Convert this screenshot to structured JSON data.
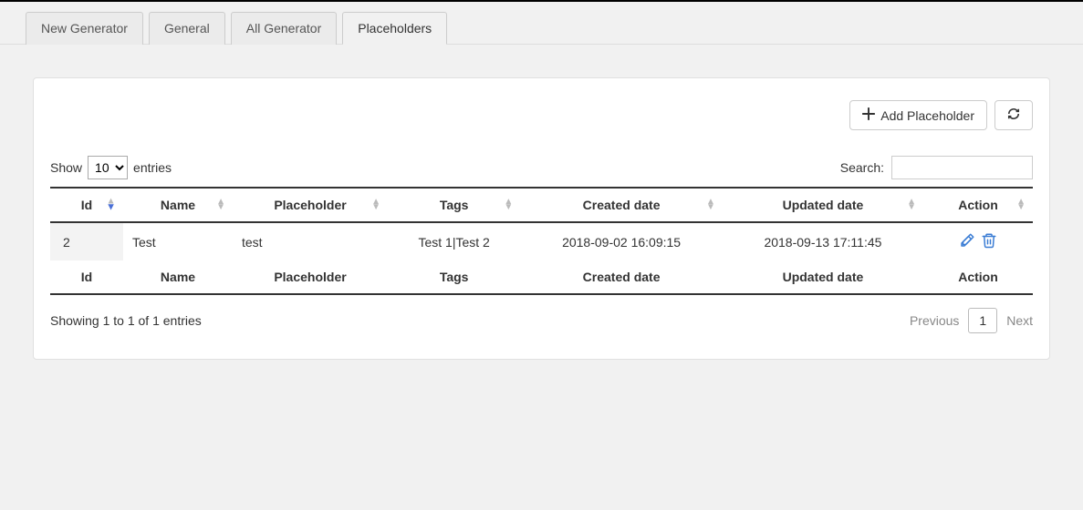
{
  "tabs": [
    {
      "label": "New Generator",
      "active": false
    },
    {
      "label": "General",
      "active": false
    },
    {
      "label": "All Generator",
      "active": false
    },
    {
      "label": "Placeholders",
      "active": true
    }
  ],
  "toolbar": {
    "add_button": "Add Placeholder"
  },
  "length": {
    "show_label": "Show",
    "entries_label": "entries",
    "selected": "10"
  },
  "search": {
    "label": "Search:",
    "value": ""
  },
  "columns": {
    "id": "Id",
    "name": "Name",
    "placeholder": "Placeholder",
    "tags": "Tags",
    "created": "Created date",
    "updated": "Updated date",
    "action": "Action"
  },
  "rows": [
    {
      "id": "2",
      "name": "Test",
      "placeholder": "test",
      "tags": "Test 1|Test 2",
      "created": "2018-09-02 16:09:15",
      "updated": "2018-09-13 17:11:45"
    }
  ],
  "info": "Showing 1 to 1 of 1 entries",
  "paginate": {
    "previous": "Previous",
    "next": "Next",
    "current_page": "1"
  }
}
